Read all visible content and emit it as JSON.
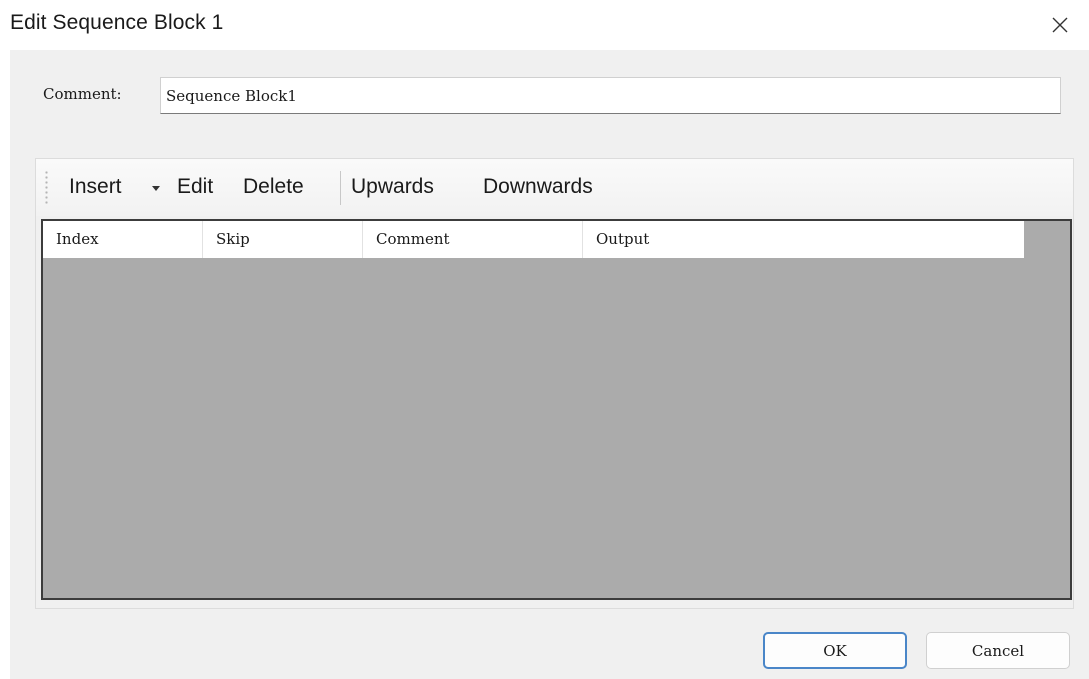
{
  "window": {
    "title": "Edit Sequence Block 1",
    "close_icon": "close-icon"
  },
  "form": {
    "comment_label": "Comment:",
    "comment_value": "Sequence Block1"
  },
  "toolbar": {
    "items": [
      "Insert",
      "Edit",
      "Delete",
      "Upwards",
      "Downwards"
    ],
    "insert_has_dropdown": true
  },
  "table": {
    "columns": [
      "Index",
      "Skip",
      "Comment",
      "Output"
    ],
    "rows": []
  },
  "buttons": {
    "ok": "OK",
    "cancel": "Cancel"
  },
  "colors": {
    "grid_background": "#ababab",
    "dialog_background": "#f0f0f0",
    "ok_border_accent": "#4a86c8"
  }
}
